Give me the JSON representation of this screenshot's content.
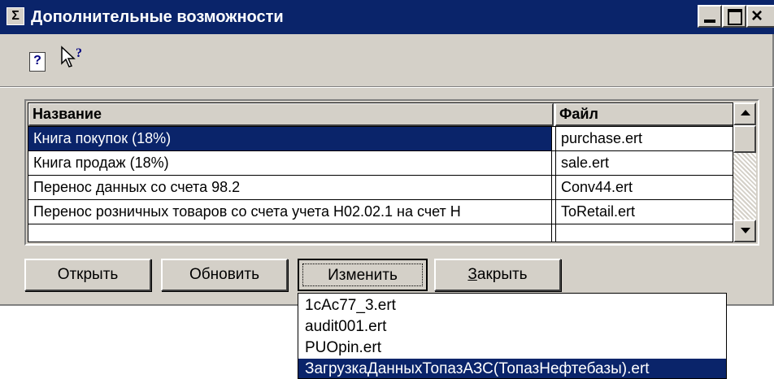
{
  "window": {
    "title": "Дополнительные возможности",
    "title_bar_color": "#0a246a",
    "face_color": "#d4d0c8",
    "icon": "sigma-app-icon",
    "icon_glyph": "Σ"
  },
  "toolbar": {
    "help_icon": "help-icon",
    "help_glyph": "?",
    "whatsthis_icon": "whats-this-pointer-icon"
  },
  "table": {
    "columns": [
      "Название",
      "Файл"
    ],
    "rows": [
      {
        "name": "Книга покупок (18%)",
        "file": "purchase.ert",
        "selected": true
      },
      {
        "name": "Книга продаж (18%)",
        "file": "sale.ert",
        "selected": false
      },
      {
        "name": "Перенос данных со счета 98.2",
        "file": "Conv44.ert",
        "selected": false
      },
      {
        "name": "Перенос розничных товаров со счета учета Н02.02.1 на счет Н",
        "file": "ToRetail.ert",
        "selected": false
      }
    ],
    "selection_color": "#0a246a"
  },
  "buttons": {
    "open": "Открыть",
    "refresh": "Обновить",
    "edit": "Изменить",
    "close_prefix": "З",
    "close_rest": "акрыть"
  },
  "dropdown": {
    "items": [
      "1cAc77_3.ert",
      "audit001.ert",
      "PUOpin.ert",
      "ЗагрузкаДанныхТопазАЗС(ТопазНефтебазы).ert"
    ],
    "selected_index": 3
  }
}
